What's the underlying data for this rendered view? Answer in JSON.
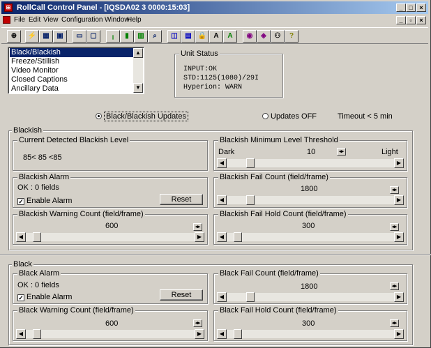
{
  "window": {
    "title": "RollCall Control Panel - [IQSDA02 3 0000:15:03]"
  },
  "menu": [
    "File",
    "Edit",
    "View",
    "Configuration",
    "Window",
    "Help"
  ],
  "listbox": {
    "items": [
      "Black/Blackish",
      "Freeze/Stillish",
      "Video Monitor",
      "Closed Captions",
      "Ancillary Data"
    ],
    "selected_index": 0
  },
  "unit_status": {
    "label": "Unit Status",
    "lines": [
      "INPUT:OK",
      "STD:1125(1080)/29I",
      "Hyperion: WARN"
    ]
  },
  "updates": {
    "on_label": "Black/Blackish Updates",
    "off_label": "Updates OFF",
    "timeout": "Timeout < 5 min",
    "selected": "on"
  },
  "blackish": {
    "label": "Blackish",
    "level": {
      "label": "Current Detected Blackish Level",
      "value": "85< 85 <85"
    },
    "threshold": {
      "label": "Blackish Minimum Level Threshold",
      "dark": "Dark",
      "light": "Light",
      "value": "10",
      "position": 0.12
    },
    "alarm": {
      "label": "Blackish Alarm",
      "status": "OK : 0 fields",
      "enable_label": "Enable Alarm",
      "enabled": true,
      "reset_label": "Reset"
    },
    "fail_count": {
      "label": "Blackish Fail Count (field/frame)",
      "value": "1800",
      "position": 0.12
    },
    "warning_count": {
      "label": "Blackish Warning Count (field/frame)",
      "value": "600",
      "position": 0.04
    },
    "fail_hold": {
      "label": "Blackish Fail Hold Count (field/frame)",
      "value": "300",
      "position": 0.04
    }
  },
  "black": {
    "label": "Black",
    "alarm": {
      "label": "Black Alarm",
      "status": "OK : 0 fields",
      "enable_label": "Enable Alarm",
      "enabled": true,
      "reset_label": "Reset"
    },
    "fail_count": {
      "label": "Black Fail Count (field/frame)",
      "value": "1800",
      "position": 0.12
    },
    "warning_count": {
      "label": "Black Warning Count (field/frame)",
      "value": "600",
      "position": 0.04
    },
    "fail_hold": {
      "label": "Black Fail Hold Count (field/frame)",
      "value": "300",
      "position": 0.04
    }
  }
}
